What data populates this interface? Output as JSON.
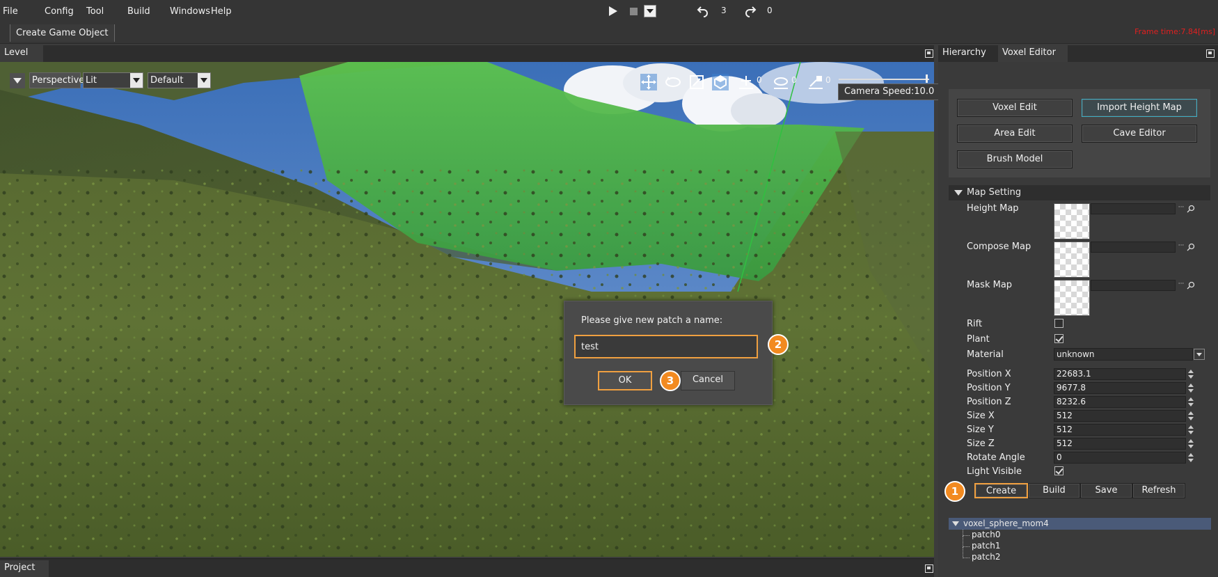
{
  "menu": {
    "items": [
      "File",
      "Config",
      "Tool",
      "Build",
      "Windows",
      "Help"
    ],
    "undo_count": "3",
    "redo_count": "0"
  },
  "toolbar": {
    "create_game_object": "Create Game Object",
    "frame_time": "Frame time:7.84[ms]"
  },
  "level_panel": {
    "tab": "Level",
    "perspective_button": "Perspective",
    "shading_select": "Lit",
    "layer_select": "Default",
    "translate_snap": "0",
    "rotate_snap": "0",
    "scale_snap": "0",
    "camera_speed": "Camera Speed:10.0"
  },
  "dialog": {
    "message": "Please give new patch a name:",
    "input_value": "test",
    "ok_label": "OK",
    "cancel_label": "Cancel",
    "step2": "2",
    "step3": "3"
  },
  "project_panel": {
    "tab": "Project"
  },
  "right_panel": {
    "tabs": [
      "Hierarchy",
      "Voxel Editor"
    ],
    "buttons": {
      "voxel_edit": "Voxel Edit",
      "import_height_map": "Import Height Map",
      "area_edit": "Area Edit",
      "cave_editor": "Cave Editor",
      "brush_model": "Brush Model"
    },
    "map_setting": {
      "title": "Map Setting",
      "height_map": "Height Map",
      "compose_map": "Compose Map",
      "mask_map": "Mask Map",
      "rift": "Rift",
      "rift_checked": false,
      "plant": "Plant",
      "plant_checked": true,
      "material": "Material",
      "material_value": "unknown",
      "position_x": "Position X",
      "position_x_value": "22683.1",
      "position_y": "Position Y",
      "position_y_value": "9677.8",
      "position_z": "Position Z",
      "position_z_value": "8232.6",
      "size_x": "Size X",
      "size_x_value": "512",
      "size_y": "Size Y",
      "size_y_value": "512",
      "size_z": "Size Z",
      "size_z_value": "512",
      "rotate_angle": "Rotate Angle",
      "rotate_angle_value": "0",
      "light_visible": "Light Visible",
      "light_visible_checked": true
    },
    "actions": {
      "create": "Create",
      "build": "Build",
      "save": "Save",
      "refresh": "Refresh",
      "step1": "1"
    },
    "tree": {
      "root": "voxel_sphere_mom4",
      "children": [
        "patch0",
        "patch1",
        "patch2"
      ]
    }
  },
  "colors": {
    "highlight_orange": "#f0a040",
    "badge_orange": "#f28a20",
    "frame_time_red": "#e02020",
    "active_button_cyan": "#3ab0c8",
    "tree_selection": "#4a5a78"
  }
}
